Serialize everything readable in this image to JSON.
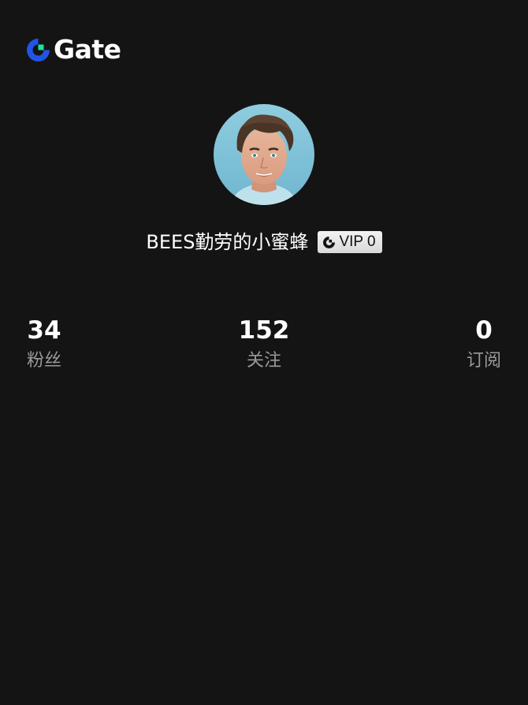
{
  "brand": {
    "name": "Gate",
    "accent_color": "#2354e6",
    "accent_secondary": "#17e6a1"
  },
  "profile": {
    "avatar_icon": "user-avatar-photo",
    "username": "BEES勤劳的小蜜蜂",
    "vip_badge": {
      "icon": "gate-logo-icon",
      "label": "VIP 0"
    }
  },
  "stats": [
    {
      "value": "34",
      "label": "粉丝"
    },
    {
      "value": "152",
      "label": "关注"
    },
    {
      "value": "0",
      "label": "订阅"
    }
  ]
}
